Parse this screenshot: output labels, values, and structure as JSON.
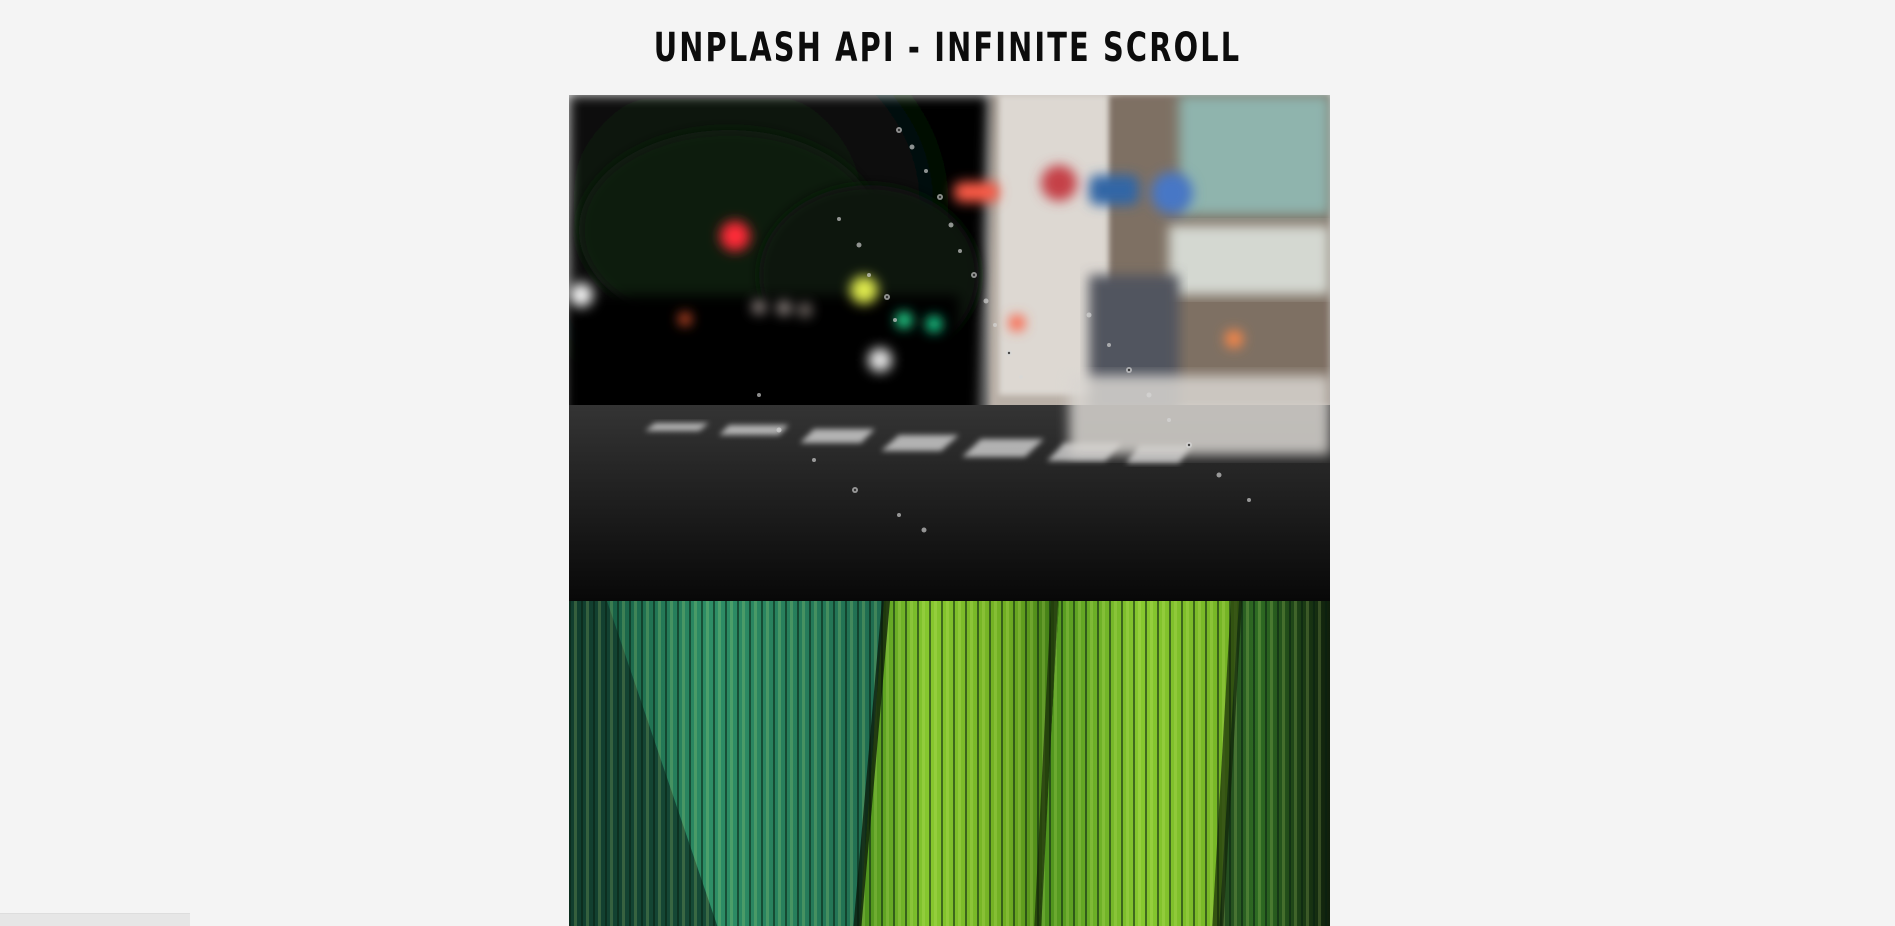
{
  "page": {
    "title": "UNPLASH API - INFINITE SCROLL",
    "background": "#f4f4f4"
  },
  "photos": [
    {
      "description": "blurred rainy city street through window with raindrops",
      "dominant_color": "#1b1b1b"
    },
    {
      "description": "close-up of green pleated palm leaves",
      "dominant_color": "#4c8f2b"
    }
  ]
}
